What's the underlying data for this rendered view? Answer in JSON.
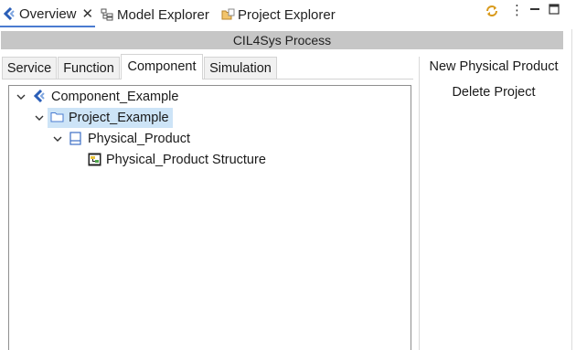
{
  "view_tabs": [
    {
      "label": "Overview",
      "icon": "cil4sys-logo-icon",
      "active": true
    },
    {
      "label": "Model Explorer",
      "icon": "model-explorer-icon",
      "active": false
    },
    {
      "label": "Project Explorer",
      "icon": "project-explorer-icon",
      "active": false
    }
  ],
  "view_toolbar": {
    "close_glyph": "✕",
    "menu_glyph": "⋮"
  },
  "header": {
    "title": "CIL4Sys Process"
  },
  "inner_tabs": [
    {
      "label": "Service",
      "active": false
    },
    {
      "label": "Function",
      "active": false
    },
    {
      "label": "Component",
      "active": true
    },
    {
      "label": "Simulation",
      "active": false
    }
  ],
  "tree": {
    "nodes": [
      {
        "label": "Component_Example",
        "icon": "cil4sys-logo-icon",
        "expanded": true,
        "level": 0
      },
      {
        "label": "Project_Example",
        "icon": "folder-icon",
        "expanded": true,
        "level": 1,
        "selected": true
      },
      {
        "label": "Physical_Product",
        "icon": "product-icon",
        "expanded": true,
        "level": 2
      },
      {
        "label": "Physical_Product Structure",
        "icon": "structure-diagram-icon",
        "level": 3
      }
    ]
  },
  "actions": [
    {
      "label": "New Physical Product"
    },
    {
      "label": "Delete Project"
    }
  ],
  "colors": {
    "accent": "#4a7bd0",
    "selection": "#cde4f7",
    "header_band": "#c6c6c6",
    "logo_blue": "#2b5fb8"
  }
}
